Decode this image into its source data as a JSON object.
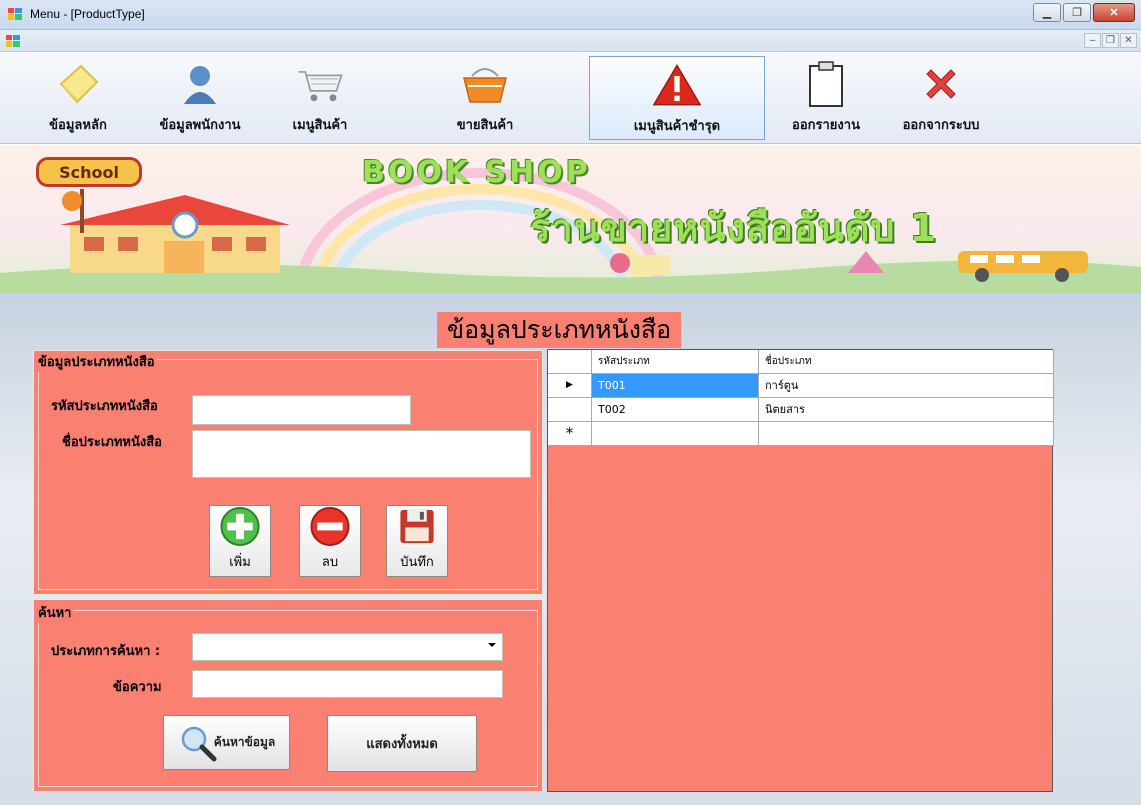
{
  "window": {
    "title": "Menu - [ProductType]"
  },
  "toolbar": {
    "items": [
      {
        "label": "ข้อมูลหลัก",
        "icon": "notepad-icon"
      },
      {
        "label": "ข้อมูลพนักงาน",
        "icon": "user-icon"
      },
      {
        "label": "เมนูสินค้า",
        "icon": "shopping-cart-icon"
      },
      {
        "label": "ขายสินค้า",
        "icon": "basket-icon"
      },
      {
        "label": "เมนูสินค้าชำรุด",
        "icon": "warning-icon"
      },
      {
        "label": "ออกรายงาน",
        "icon": "clipboard-icon"
      },
      {
        "label": "ออกจากระบบ",
        "icon": "close-x-icon"
      }
    ],
    "active_index": 4
  },
  "banner": {
    "title": "BOOK SHOP",
    "subtitle": "ร้านขายหนังสืออันดับ 1",
    "school_sign": "School"
  },
  "page_title": "ข้อมูลประเภทหนังสือ",
  "form": {
    "legend": "ข้อมูลประเภทหนังสือ",
    "code_label": "รหัสประเภทหนังสือ",
    "code_value": "",
    "name_label": "ชื่อประเภทหนังสือ",
    "name_value": "",
    "add_label": "เพิ่ม",
    "delete_label": "ลบ",
    "save_label": "บันทึก"
  },
  "search": {
    "legend": "ค้นหา",
    "type_label": "ประเภทการค้นหา :",
    "type_value": "",
    "text_label": "ข้อความ",
    "text_value": "",
    "search_button": "ค้นหาข้อมูล",
    "show_all_button": "แสดงทั้งหมด"
  },
  "grid": {
    "columns": [
      "รหัสประเภท",
      "ชื่อประเภท"
    ],
    "rows": [
      {
        "code": "T001",
        "name": "การ์ตูน"
      },
      {
        "code": "T002",
        "name": "นิตยสาร"
      }
    ],
    "new_row_marker": "*",
    "current_row_marker": "▶"
  },
  "colors": {
    "panel": "#fa8072",
    "selection": "#3399ff",
    "banner_text": "#9fe05a"
  }
}
